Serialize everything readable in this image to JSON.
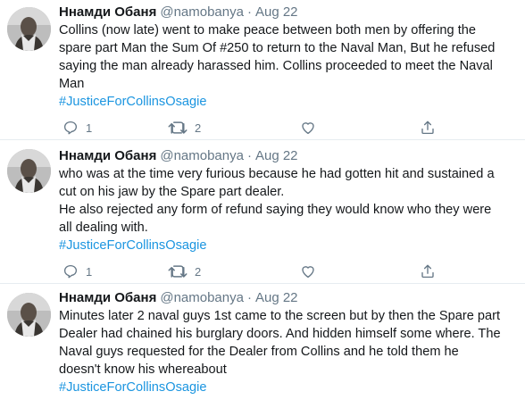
{
  "tweets": [
    {
      "author_name": "Ннамди Обаня",
      "handle": "@namobanya",
      "separator": "·",
      "date": "Aug 22",
      "lines": [
        "Collins (now late) went to make peace between both men by offering the",
        "spare part Man the Sum Of #250 to return to the Naval Man, But he refused",
        "saying the man  already harassed him. Collins proceeded to meet the Naval",
        "Man"
      ],
      "hashtag": "#JusticeForCollinsOsagie",
      "reply_count": "1",
      "retweet_count": "2",
      "like_count": "",
      "share_label": ""
    },
    {
      "author_name": "Ннамди Обаня",
      "handle": "@namobanya",
      "separator": "·",
      "date": "Aug 22",
      "lines": [
        "who was at the time very furious because he had gotten hit and sustained a",
        "cut on his jaw by the Spare part dealer.",
        "He also rejected any form of refund saying they would know who they were",
        "all dealing with."
      ],
      "hashtag": "#JusticeForCollinsOsagie",
      "reply_count": "1",
      "retweet_count": "2",
      "like_count": "",
      "share_label": ""
    },
    {
      "author_name": "Ннамди Обаня",
      "handle": "@namobanya",
      "separator": "·",
      "date": "Aug 22",
      "lines": [
        "Minutes later 2 naval guys 1st came to the screen but by then the Spare part",
        "Dealer had chained his burglary doors. And hidden himself some where. The",
        "Naval guys requested for the Dealer from Collins and he told them he",
        "doesn't know his whereabout"
      ],
      "hashtag": "#JusticeForCollinsOsagie"
    }
  ],
  "icons": {
    "reply": "reply-icon",
    "retweet": "retweet-icon",
    "like": "heart-icon",
    "share": "share-icon"
  },
  "colors": {
    "name": "#14171a",
    "meta": "#657786",
    "hashtag": "#1b95e0",
    "divider": "#e6ecf0"
  }
}
